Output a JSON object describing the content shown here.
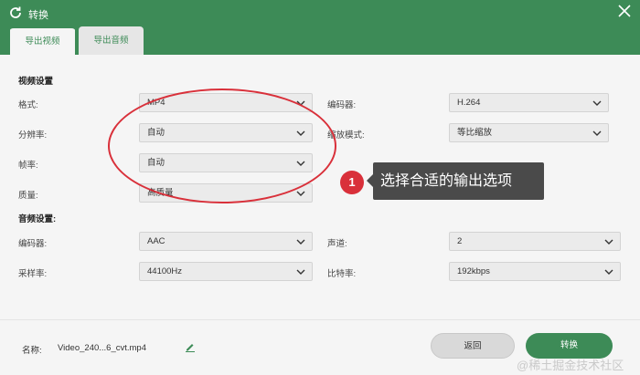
{
  "window": {
    "title": "转换",
    "app_icon": "refresh-icon",
    "close_icon": "close-icon"
  },
  "tabs": [
    {
      "label": "导出视频",
      "active": true
    },
    {
      "label": "导出音频",
      "active": false
    }
  ],
  "video_settings": {
    "title": "视频设置",
    "format": {
      "label": "格式:",
      "value": "MP4"
    },
    "encoder": {
      "label": "编码器:",
      "value": "H.264"
    },
    "resolution": {
      "label": "分辨率:",
      "value": "自动"
    },
    "scale_mode": {
      "label": "缩放模式:",
      "value": "等比缩放"
    },
    "frame_rate": {
      "label": "帧率:",
      "value": "自动"
    },
    "quality": {
      "label": "质量:",
      "value": "高质量"
    }
  },
  "audio_settings": {
    "title": "音频设置:",
    "encoder": {
      "label": "编码器:",
      "value": "AAC"
    },
    "channels": {
      "label": "声道:",
      "value": "2"
    },
    "sample_rate": {
      "label": "采样率:",
      "value": "44100Hz"
    },
    "bitrate": {
      "label": "比特率:",
      "value": "192kbps"
    }
  },
  "footer": {
    "name_label": "名称:",
    "filename": "Video_240...6_cvt.mp4",
    "back_label": "返回",
    "convert_label": "转换"
  },
  "annotation": {
    "step_number": "1",
    "text": "选择合适的输出选项"
  },
  "watermark": "@稀土掘金技术社区",
  "colors": {
    "accent": "#3d8b57",
    "highlight": "#d9303a"
  }
}
